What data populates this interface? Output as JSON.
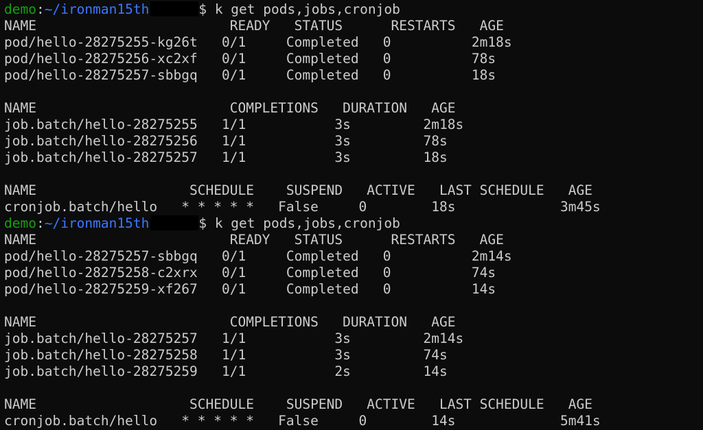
{
  "colors": {
    "background": "#0c0c0c",
    "text": "#cccccc",
    "prompt_user": "#13a10e",
    "prompt_path": "#3b78ff"
  },
  "blocks": [
    {
      "prompt": {
        "user": "demo",
        "sep": ":",
        "path": "~/ironman15th",
        "symbol": "$ ",
        "command": "k get pods,jobs,cronjob"
      },
      "lines": [
        "NAME                        READY   STATUS      RESTARTS   AGE",
        "pod/hello-28275255-kg26t   0/1     Completed   0          2m18s",
        "pod/hello-28275256-xc2xf   0/1     Completed   0          78s",
        "pod/hello-28275257-sbbgq   0/1     Completed   0          18s",
        "",
        "NAME                        COMPLETIONS   DURATION   AGE",
        "job.batch/hello-28275255   1/1           3s         2m18s",
        "job.batch/hello-28275256   1/1           3s         78s",
        "job.batch/hello-28275257   1/1           3s         18s",
        "",
        "NAME                   SCHEDULE    SUSPEND   ACTIVE   LAST SCHEDULE   AGE",
        "cronjob.batch/hello   * * * * *   False     0        18s             3m45s"
      ]
    },
    {
      "prompt": {
        "user": "demo",
        "sep": ":",
        "path": "~/ironman15th",
        "symbol": "$ ",
        "command": "k get pods,jobs,cronjob"
      },
      "lines": [
        "NAME                        READY   STATUS      RESTARTS   AGE",
        "pod/hello-28275257-sbbgq   0/1     Completed   0          2m14s",
        "pod/hello-28275258-c2xrx   0/1     Completed   0          74s",
        "pod/hello-28275259-xf267   0/1     Completed   0          14s",
        "",
        "NAME                        COMPLETIONS   DURATION   AGE",
        "job.batch/hello-28275257   1/1           3s         2m14s",
        "job.batch/hello-28275258   1/1           3s         74s",
        "job.batch/hello-28275259   1/1           2s         14s",
        "",
        "NAME                   SCHEDULE    SUSPEND   ACTIVE   LAST SCHEDULE   AGE",
        "cronjob.batch/hello   * * * * *   False     0        14s             5m41s"
      ]
    }
  ]
}
